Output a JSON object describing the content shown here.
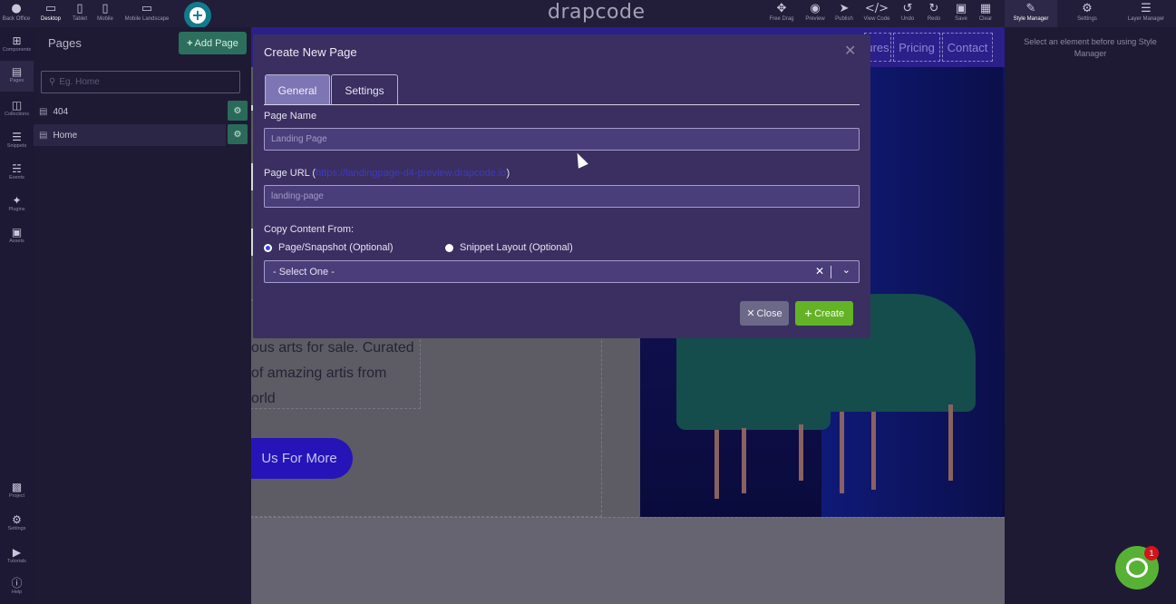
{
  "toolbar": {
    "back_office": "Back Office",
    "devices": [
      "Desktop",
      "Tablet",
      "Mobile",
      "Mobile Landscape"
    ],
    "logo": "drapcode",
    "actions": [
      "Free Drag",
      "Preview",
      "Publish",
      "View Code",
      "Undo",
      "Redo",
      "Save",
      "Clear"
    ],
    "panels": [
      "Style Manager",
      "Settings",
      "Layer Manager"
    ]
  },
  "rail": {
    "items": [
      "Components",
      "Pages",
      "Collections",
      "Snippets",
      "Events",
      "Plugins",
      "Assets"
    ],
    "bottom_items": [
      "Project",
      "Settings",
      "Tutorials",
      "Help"
    ]
  },
  "pages_panel": {
    "title": "Pages",
    "add_button": "Add Page",
    "search_placeholder": "Eg. Home",
    "pages": [
      "404",
      "Home"
    ]
  },
  "site": {
    "nav_links": [
      "ures",
      "Pricing",
      "Contact"
    ],
    "hero_lines": [
      "ous arts for sale. Curated",
      "of amazing artis from",
      "orld"
    ],
    "cta": "Us For More"
  },
  "right_panel": {
    "hint": "Select an element before using Style Manager"
  },
  "modal": {
    "title": "Create New Page",
    "tabs": [
      "General",
      "Settings"
    ],
    "page_name_label": "Page Name",
    "page_name_value": "Landing Page",
    "page_url_label_prefix": "Page URL (",
    "page_url_link": "https://landingpage-d4-preview.drapcode.io",
    "page_url_label_suffix": ")",
    "page_url_value": "landing-page",
    "copy_label": "Copy Content From:",
    "radio_page": "Page/Snapshot (Optional)",
    "radio_snippet": "Snippet Layout (Optional)",
    "select_value": "- Select One -",
    "close_button": "Close",
    "create_button": "Create"
  },
  "chat": {
    "badge": "1"
  }
}
